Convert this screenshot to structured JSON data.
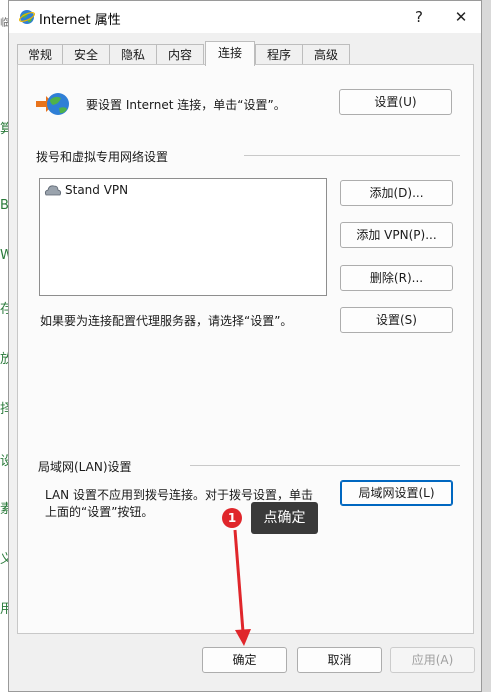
{
  "window": {
    "title": "Internet 属性",
    "help_glyph": "?",
    "close_glyph": "✕"
  },
  "tabs": [
    {
      "label": "常规",
      "active": false
    },
    {
      "label": "安全",
      "active": false
    },
    {
      "label": "隐私",
      "active": false
    },
    {
      "label": "内容",
      "active": false
    },
    {
      "label": "连接",
      "active": true
    },
    {
      "label": "程序",
      "active": false
    },
    {
      "label": "高级",
      "active": false
    }
  ],
  "setup": {
    "text": "要设置 Internet 连接，单击“设置”。",
    "button": "设置(U)"
  },
  "dialup": {
    "heading": "拨号和虚拟专用网络设置",
    "items": [
      "Stand VPN"
    ],
    "add_button": "添加(D)...",
    "add_vpn_button": "添加 VPN(P)...",
    "delete_button": "删除(R)...",
    "proxy_text": "如果要为连接配置代理服务器，请选择“设置”。",
    "settings_button": "设置(S)"
  },
  "lan": {
    "heading": "局域网(LAN)设置",
    "text_line1": "LAN 设置不应用到拨号连接。对于拨号设置，单击",
    "text_line2": "上面的“设置”按钮。",
    "button": "局域网设置(L)"
  },
  "footer": {
    "ok": "确定",
    "cancel": "取消",
    "apply": "应用(A)"
  },
  "annotation": {
    "step": "1",
    "text": "点确定"
  },
  "background_chars": [
    "临",
    "算",
    "B",
    "W",
    "存",
    "放",
    "择",
    "设",
    "素",
    "义",
    "用"
  ],
  "colors": {
    "accent": "#0067c0",
    "annotation_red": "#e0262b"
  }
}
